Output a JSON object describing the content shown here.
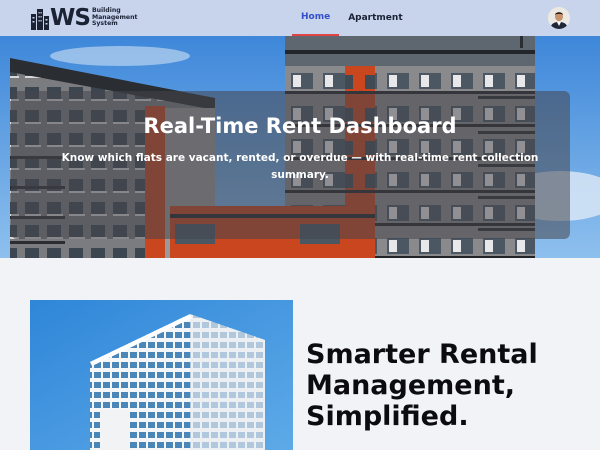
{
  "brand": {
    "initials": "WS",
    "line1": "Building",
    "line2": "Management",
    "line3": "System"
  },
  "nav": {
    "items": [
      {
        "label": "Home",
        "active": true
      },
      {
        "label": "Apartment",
        "active": false
      }
    ]
  },
  "user": {
    "avatar_icon": "user-avatar"
  },
  "hero": {
    "title": "Real-Time Rent Dashboard",
    "subtitle": "Know which flats are vacant, rented, or overdue — with real-time rent collection summary."
  },
  "feature": {
    "heading": "Smarter Rental Management, Simplified."
  },
  "colors": {
    "navbar_bg": "#c8d3ec",
    "nav_active": "#3350c9",
    "nav_underline": "#e04545",
    "page_bg": "#f2f3f6",
    "sky": "#4f97e0"
  }
}
